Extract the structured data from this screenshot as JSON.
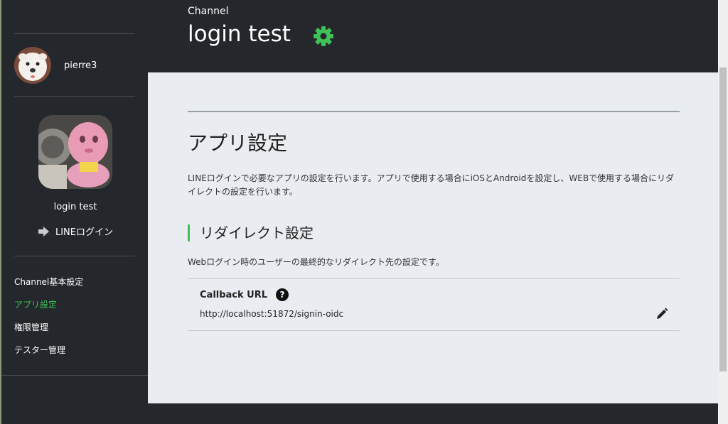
{
  "sidebar": {
    "user_name": "pierre3",
    "channel_name": "login test",
    "channel_type": "LINEログイン",
    "nav": [
      {
        "label": "Channel基本設定",
        "active": false
      },
      {
        "label": "アプリ設定",
        "active": true
      },
      {
        "label": "権限管理",
        "active": false
      },
      {
        "label": "テスター管理",
        "active": false
      }
    ]
  },
  "header": {
    "eyebrow": "Channel",
    "title": "login test"
  },
  "main": {
    "heading": "アプリ設定",
    "description": "LINEログインで必要なアプリの設定を行います。アプリで使用する場合にiOSとAndroidを設定し、WEBで使用する場合にリダイレクトの設定を行います。",
    "section_title": "リダイレクト設定",
    "section_description": "Webログイン時のユーザーの最終的なリダイレクト先の設定です。",
    "field": {
      "label": "Callback URL",
      "help_symbol": "?",
      "value": "http://localhost:51872/signin-oidc"
    }
  },
  "colors": {
    "accent_green": "#3fc157",
    "dark_bg": "#24272b",
    "content_bg": "#e9edf1"
  },
  "icons": {
    "settings": "gear-icon",
    "edit": "pencil-icon",
    "channel_type": "arrow-right-icon",
    "help": "question-circle-icon"
  }
}
